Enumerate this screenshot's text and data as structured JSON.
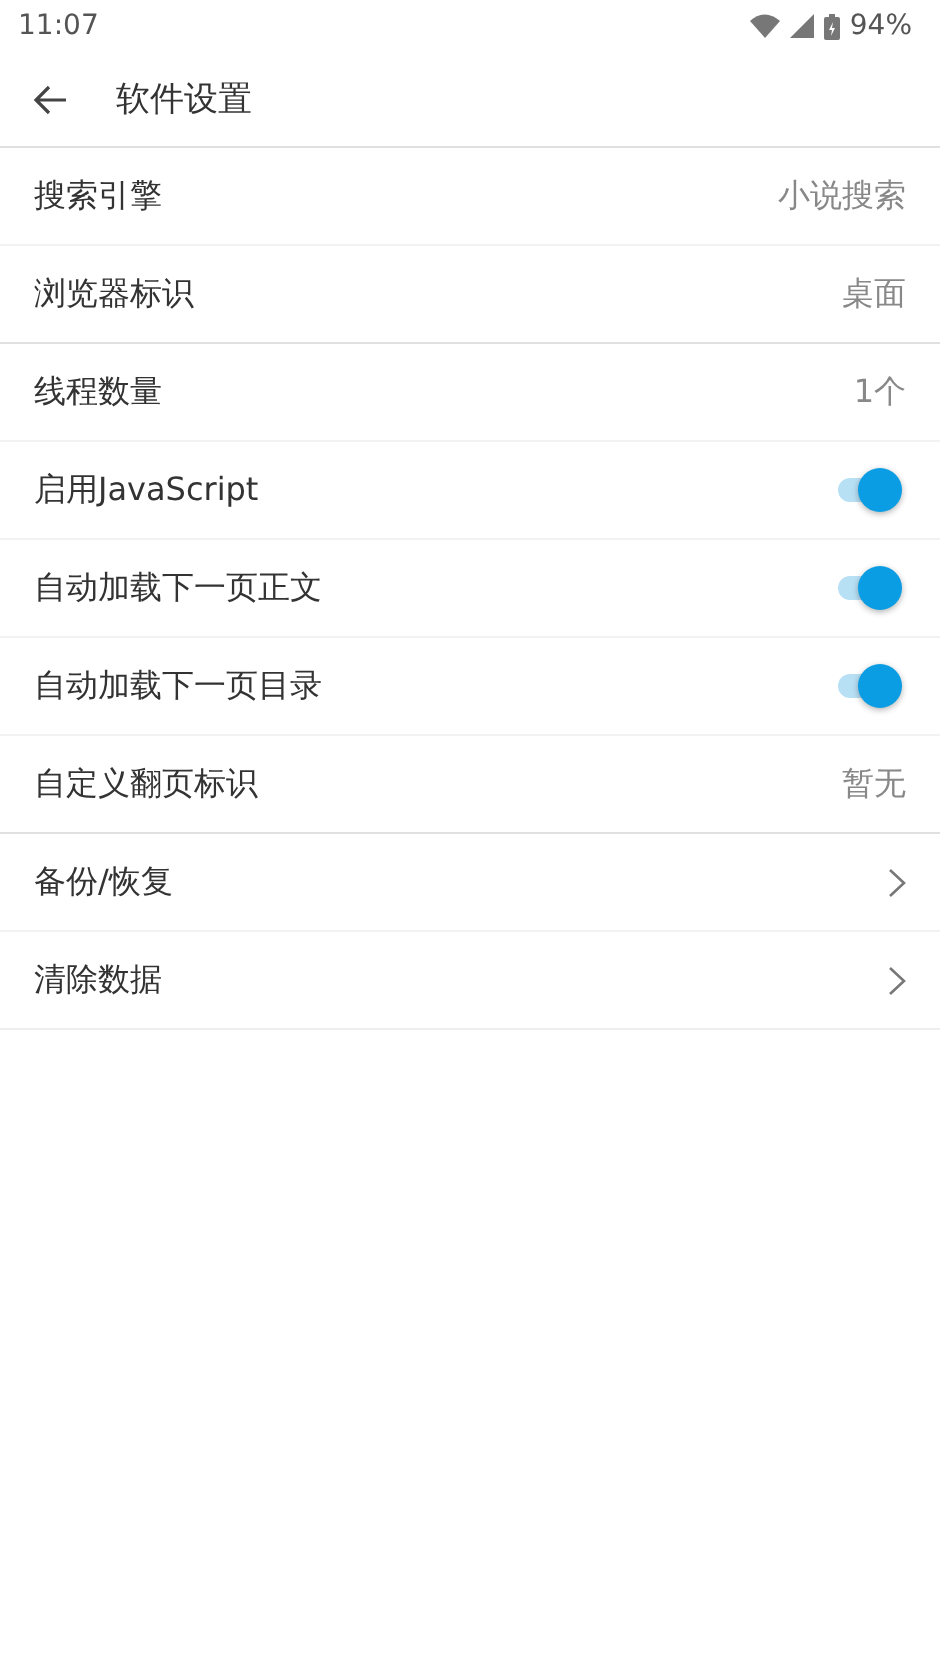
{
  "status_bar": {
    "time": "11:07",
    "battery": "94%"
  },
  "app_bar": {
    "title": "软件设置"
  },
  "groups": [
    [
      {
        "kind": "value",
        "label": "搜索引擎",
        "value": "小说搜索"
      },
      {
        "kind": "value",
        "label": "浏览器标识",
        "value": "桌面"
      }
    ],
    [
      {
        "kind": "value",
        "label": "线程数量",
        "value": "1个"
      },
      {
        "kind": "switch",
        "label": "启用JavaScript",
        "on": true
      },
      {
        "kind": "switch",
        "label": "自动加载下一页正文",
        "on": true
      },
      {
        "kind": "switch",
        "label": "自动加载下一页目录",
        "on": true
      },
      {
        "kind": "value",
        "label": "自定义翻页标识",
        "value": "暂无"
      }
    ],
    [
      {
        "kind": "link",
        "label": "备份/恢复"
      },
      {
        "kind": "link",
        "label": "清除数据"
      }
    ]
  ]
}
